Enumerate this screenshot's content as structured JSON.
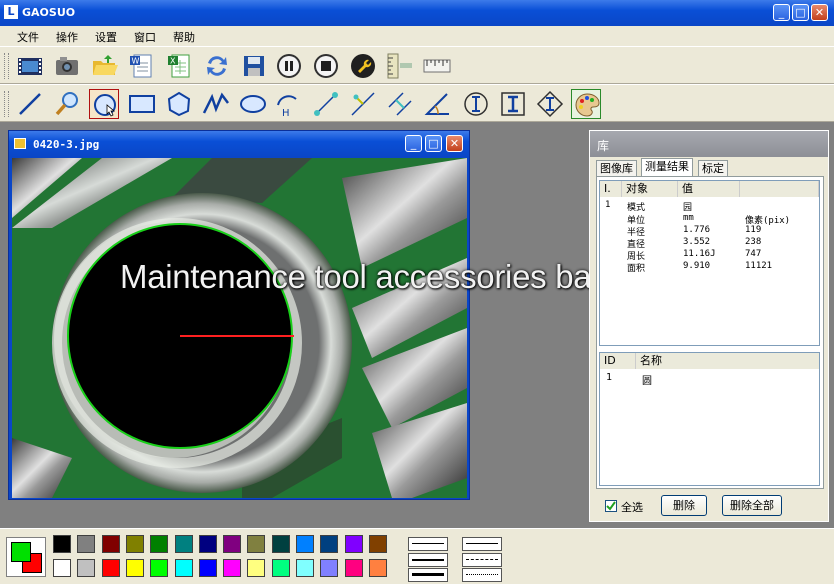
{
  "app": {
    "title": "GAOSUO",
    "icon_letter": "L",
    "minimize": "_",
    "maximize": "□",
    "close": "✕"
  },
  "menu": [
    {
      "label": "文件"
    },
    {
      "label": "操作"
    },
    {
      "label": "设置"
    },
    {
      "label": "窗口"
    },
    {
      "label": "帮助"
    }
  ],
  "toolbar1": [
    "film-icon",
    "camera-icon",
    "open-folder-icon",
    "word-export-icon",
    "excel-export-icon",
    "refresh-icon",
    "save-icon",
    "pause-icon",
    "stop-icon",
    "wrench-icon",
    "vertical-ruler-icon",
    "horizontal-ruler-icon"
  ],
  "toolbar2": [
    "line-tool-icon",
    "zoom-tool-icon",
    "circle-select-tool-icon",
    "rectangle-tool-icon",
    "polygon-tool-icon",
    "polyline-tool-icon",
    "ellipse-tool-icon",
    "arc-tool-icon",
    "distance-tool-icon",
    "point-line-distance-icon",
    "parallel-distance-icon",
    "angle-tool-icon",
    "i-beam-circle-icon",
    "i-beam-box-icon",
    "i-beam-diamond-icon",
    "palette-icon"
  ],
  "image_window": {
    "title": "0420-3.jpg"
  },
  "watermark": "Maintenance tool accessories base",
  "library": {
    "title": "库",
    "tabs": [
      {
        "label": "图像库"
      },
      {
        "label": "测量结果"
      },
      {
        "label": "标定"
      }
    ],
    "results_headers": [
      "I.",
      "对象",
      "值"
    ],
    "results": [
      {
        "id": "1",
        "name": "模式",
        "value": "园",
        "extra": ""
      },
      {
        "id": "",
        "name": "单位",
        "value": "mm",
        "extra": "像素(pix)"
      },
      {
        "id": "",
        "name": "半径",
        "value": "1.776",
        "extra": "119"
      },
      {
        "id": "",
        "name": "直径",
        "value": "3.552",
        "extra": "238"
      },
      {
        "id": "",
        "name": "周长",
        "value": "11.16J",
        "extra": "747"
      },
      {
        "id": "",
        "name": "面积",
        "value": "9.910",
        "extra": "11121"
      }
    ],
    "objects_headers": [
      "ID",
      "名称"
    ],
    "objects": [
      {
        "id": "1",
        "name": "圆"
      }
    ],
    "select_all": "全选",
    "delete": "删除",
    "delete_all": "删除全部"
  },
  "palette": {
    "foreground": "#00e000",
    "background": "#ff0000",
    "row1": [
      "#000000",
      "#808080",
      "#800000",
      "#808000",
      "#008000",
      "#008080",
      "#000080",
      "#800080",
      "#808040",
      "#004040",
      "#0080ff",
      "#004080",
      "#8000ff",
      "#804000"
    ],
    "row2": [
      "#ffffff",
      "#c0c0c0",
      "#ff0000",
      "#ffff00",
      "#00ff00",
      "#00ffff",
      "#0000ff",
      "#ff00ff",
      "#ffff80",
      "#00ff80",
      "#80ffff",
      "#8080ff",
      "#ff0080",
      "#ff8040"
    ]
  },
  "colors": {
    "measure_circle": "#19d019",
    "radius_line": "#ff2020",
    "title_blue": "#0a46c7"
  }
}
